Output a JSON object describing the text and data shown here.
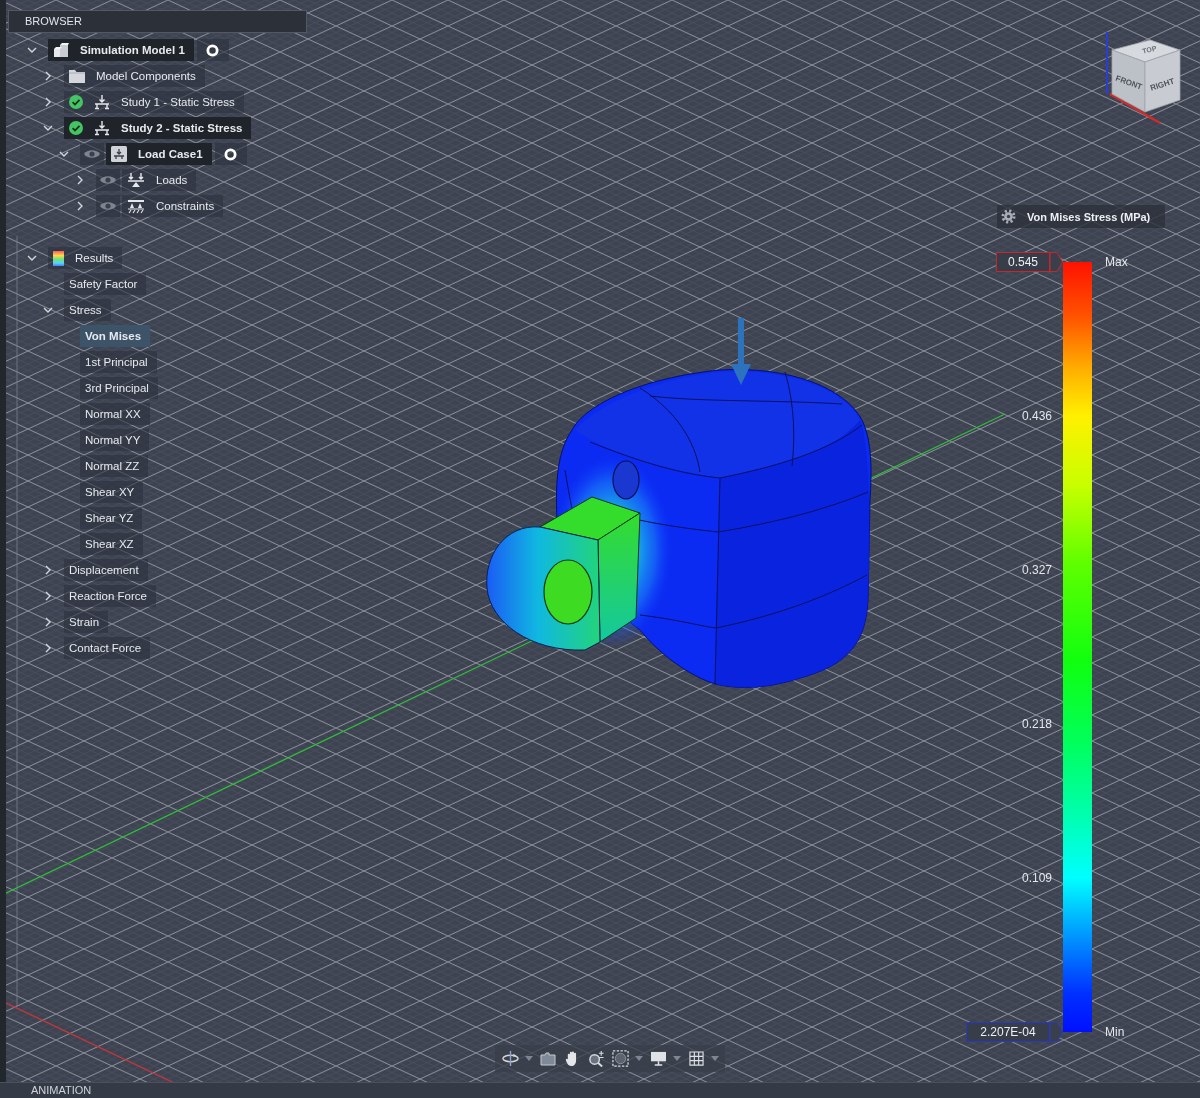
{
  "browser": {
    "title": "BROWSER",
    "tree": [
      {
        "label": "Simulation Model 1",
        "kind": "model",
        "expanded": true,
        "selected": false,
        "active": true,
        "activated": true,
        "children": [
          {
            "label": "Model Components",
            "kind": "folder",
            "expanded": false,
            "selected": false,
            "active": false,
            "activated": false
          },
          {
            "label": "Study 1 - Static Stress",
            "kind": "study",
            "solved": true,
            "expanded": false,
            "selected": false,
            "active": false,
            "activated": false
          },
          {
            "label": "Study 2 - Static Stress",
            "kind": "study",
            "solved": true,
            "expanded": true,
            "selected": false,
            "active": true,
            "activated": false,
            "children": [
              {
                "label": "Load Case1",
                "kind": "load_case",
                "visible": true,
                "expanded": true,
                "selected": false,
                "active": true,
                "activated": true,
                "children": [
                  {
                    "label": "Loads",
                    "kind": "loads",
                    "visible": true,
                    "expanded": false,
                    "selected": false,
                    "active": false,
                    "activated": false
                  },
                  {
                    "label": "Constraints",
                    "kind": "constraints",
                    "visible": true,
                    "expanded": false,
                    "selected": false,
                    "active": false,
                    "activated": false
                  }
                ]
              }
            ]
          }
        ]
      }
    ],
    "results_tree": [
      {
        "label": "Results",
        "kind": "results",
        "expanded": true,
        "selected": false,
        "active": false,
        "activated": false,
        "children": [
          {
            "label": "Safety Factor",
            "selected": false,
            "active": false,
            "activated": false
          },
          {
            "label": "Stress",
            "expanded": true,
            "selected": false,
            "active": false,
            "activated": false,
            "children": [
              {
                "label": "Von Mises",
                "selected": true,
                "active": false,
                "activated": false
              },
              {
                "label": "1st Principal",
                "selected": false,
                "active": false,
                "activated": false
              },
              {
                "label": "3rd Principal",
                "selected": false,
                "active": false,
                "activated": false
              },
              {
                "label": "Normal XX",
                "selected": false,
                "active": false,
                "activated": false
              },
              {
                "label": "Normal YY",
                "selected": false,
                "active": false,
                "activated": false
              },
              {
                "label": "Normal ZZ",
                "selected": false,
                "active": false,
                "activated": false
              },
              {
                "label": "Shear XY",
                "selected": false,
                "active": false,
                "activated": false
              },
              {
                "label": "Shear YZ",
                "selected": false,
                "active": false,
                "activated": false
              },
              {
                "label": "Shear XZ",
                "selected": false,
                "active": false,
                "activated": false
              }
            ]
          },
          {
            "label": "Displacement",
            "expanded": false,
            "selected": false,
            "active": false,
            "activated": false
          },
          {
            "label": "Reaction Force",
            "expanded": false,
            "selected": false,
            "active": false,
            "activated": false
          },
          {
            "label": "Strain",
            "expanded": false,
            "selected": false,
            "active": false,
            "activated": false
          },
          {
            "label": "Contact Force",
            "expanded": false,
            "selected": false,
            "active": false,
            "activated": false
          }
        ]
      }
    ]
  },
  "view_cube": {
    "front": "FRONT",
    "right": "RIGHT",
    "top": "TOP"
  },
  "legend": {
    "title": "Von Mises Stress (MPa)",
    "max": {
      "value": "0.545",
      "label": "Max"
    },
    "ticks": [
      "0.436",
      "0.327",
      "0.218",
      "0.109"
    ],
    "min": {
      "value": "2.207E-04",
      "label": "Min"
    }
  },
  "navigation_bar": {
    "tools": [
      {
        "kind": "orbit",
        "dropdown": true
      },
      {
        "kind": "look_at",
        "dropdown": false
      },
      {
        "kind": "pan",
        "dropdown": false
      },
      {
        "kind": "zoom",
        "dropdown": false
      },
      {
        "kind": "fit",
        "dropdown": true
      },
      {
        "kind": "display",
        "dropdown": true
      },
      {
        "kind": "grid",
        "dropdown": true
      }
    ]
  },
  "animation": {
    "title": "ANIMATION"
  }
}
